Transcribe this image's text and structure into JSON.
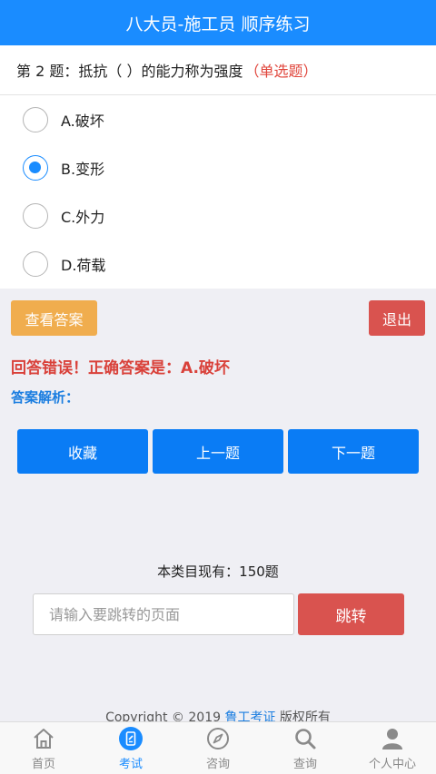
{
  "header": {
    "title": "八大员-施工员 顺序练习"
  },
  "question": {
    "text": "第 2 题：抵抗（  ）的能力称为强度",
    "type": "（单选题）"
  },
  "options": [
    {
      "label": "A.破坏",
      "checked": false
    },
    {
      "label": "B.变形",
      "checked": true
    },
    {
      "label": "C.外力",
      "checked": false
    },
    {
      "label": "D.荷载",
      "checked": false
    }
  ],
  "actions": {
    "show_answer": "查看答案",
    "exit": "退出"
  },
  "result": {
    "text": "回答错误！正确答案是：A.破坏",
    "analysis_label": "答案解析："
  },
  "nav": {
    "favorite": "收藏",
    "prev": "上一题",
    "next": "下一题"
  },
  "footer_info": {
    "total": "本类目现有：150题"
  },
  "jump": {
    "placeholder": "请输入要跳转的页面",
    "button": "跳转"
  },
  "copyright": {
    "prefix": "Copyright © 2019 ",
    "link": "鲁工考证",
    "suffix": " 版权所有"
  },
  "tabs": [
    {
      "label": "首页",
      "icon": "home-icon"
    },
    {
      "label": "考试",
      "icon": "exam-icon",
      "active": true
    },
    {
      "label": "咨询",
      "icon": "compass-icon"
    },
    {
      "label": "查询",
      "icon": "search-icon"
    },
    {
      "label": "个人中心",
      "icon": "user-icon"
    }
  ],
  "colors": {
    "primary": "#1a8cff",
    "danger": "#d9534f",
    "warning": "#f0ad4e"
  }
}
